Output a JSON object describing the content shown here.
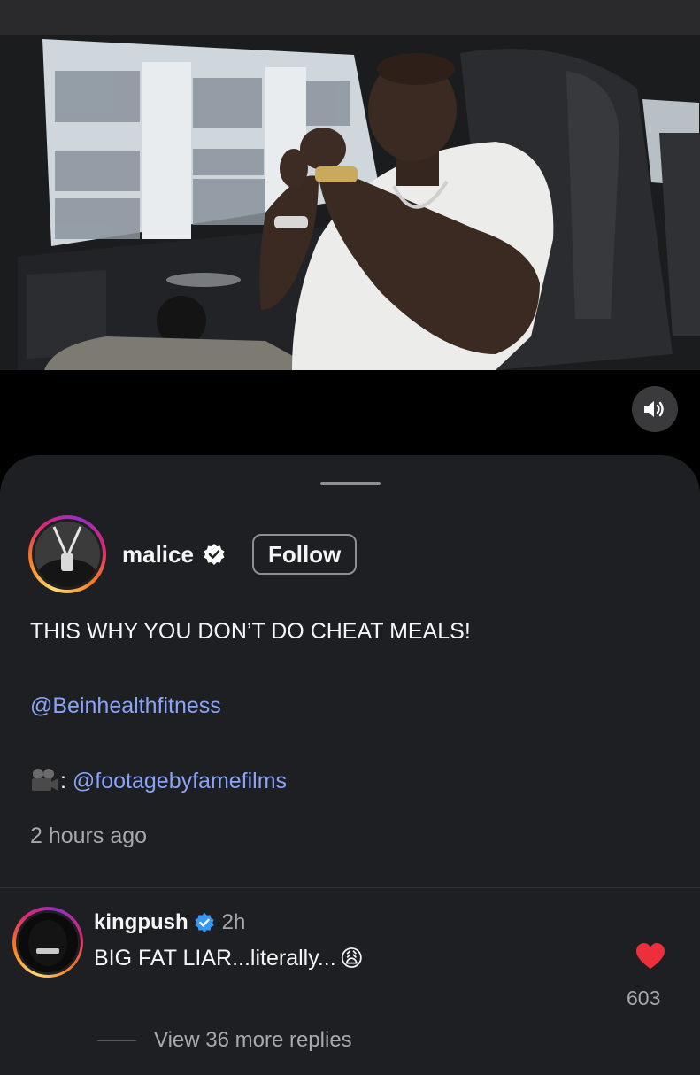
{
  "post": {
    "username": "malice",
    "follow_label": "Follow",
    "caption_line1": "THIS WHY YOU DON’T DO CHEAT MEALS!",
    "mention1": "@Beinhealthfitness",
    "credit_prefix": ": ",
    "mention2": "@footagebyfamefilms",
    "timestamp": "2 hours ago"
  },
  "comment": {
    "username": "kingpush",
    "time": "2h",
    "text": "BIG FAT LIAR...literally...",
    "emoji": "😩",
    "likes": "603",
    "view_replies": "View 36 more replies"
  },
  "colors": {
    "sheet_bg": "#1d1f23",
    "mention": "#8aa4f5",
    "verified": "#3897f0",
    "heart": "#ed2f3c"
  },
  "icons": {
    "mute": "speaker-icon",
    "verified": "verified-badge-icon",
    "camera": "movie-camera-icon",
    "like": "heart-icon"
  }
}
